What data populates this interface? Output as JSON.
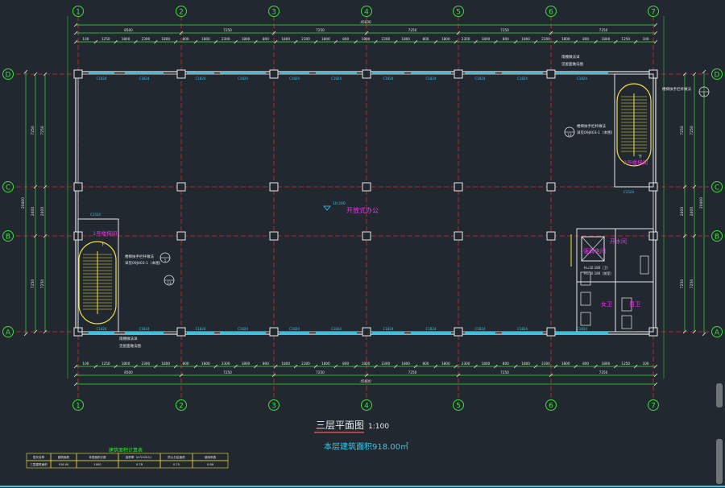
{
  "drawing": {
    "title": "三层平面图",
    "scale": "1:100",
    "area_note": "本层建筑面积918.00㎡"
  },
  "axes": {
    "columns": [
      "1",
      "2",
      "3",
      "4",
      "5",
      "6",
      "7"
    ],
    "rows": [
      "D",
      "C",
      "B",
      "A"
    ]
  },
  "dimensions": {
    "top_total": "45600",
    "bottom_total": "45600",
    "top_bays": [
      "8500",
      "7250",
      "7250",
      "7250",
      "7250",
      "7250",
      "8500"
    ],
    "bottom_bays": [
      "8500",
      "7250",
      "7250",
      "7250",
      "7250",
      "7250",
      "8500"
    ],
    "top_detail": [
      "100",
      "1250",
      "1800",
      "2300",
      "1800",
      "800",
      "1800",
      "2300",
      "1800",
      "800",
      "1800",
      "2300",
      "1800",
      "800",
      "1800",
      "2300",
      "1800",
      "800",
      "1800",
      "2300",
      "1800",
      "800",
      "1800",
      "2300",
      "1800",
      "800",
      "1800",
      "1250",
      "100"
    ],
    "bottom_detail": [
      "100",
      "1250",
      "1800",
      "2300",
      "1800",
      "800",
      "1800",
      "2300",
      "1800",
      "800",
      "1800",
      "2300",
      "1800",
      "800",
      "1800",
      "2300",
      "1800",
      "800",
      "1800",
      "2300",
      "1800",
      "800",
      "1800",
      "2300",
      "1800",
      "800",
      "1800",
      "1250",
      "100"
    ],
    "left_outer": "20400",
    "right_outer": "20400",
    "left_segments": [
      "7250",
      "2400",
      "7250"
    ],
    "right_segments": [
      "7250",
      "2400",
      "7250"
    ]
  },
  "windows": {
    "top": [
      "C1824",
      "C1824",
      "C1824",
      "C1824",
      "C1824",
      "C1824",
      "C1824",
      "C1824",
      "C1824",
      "C1824",
      "C1824"
    ],
    "bottom": [
      "C1824",
      "C1824",
      "C1824",
      "C1824",
      "C1824",
      "C1824",
      "C1824",
      "C1824",
      "C1824",
      "C1824",
      "C1824"
    ]
  },
  "rooms": {
    "main": "开放式办公",
    "stair_left": "1号楼梯间",
    "stair_right": "2号楼梯间",
    "open_area": "开水间",
    "equip_room": "强弱电间",
    "female_wc": "女卫",
    "male_wc": "男卫"
  },
  "annotations": {
    "elev_main": "10.200",
    "top_note": [
      "雨棚做法详",
      "见屋面做法图"
    ],
    "bottom_note": [
      "雨棚做法详",
      "见屋面做法图"
    ],
    "stair_note_left": [
      "楼梯扶手栏杆做法",
      "详见09J403-1（本图）"
    ],
    "stair_note_right": [
      "楼梯扶手栏杆做法",
      "详见09J403-1（本图）"
    ],
    "detail_ref_left": "13",
    "detail_ref_right": "13",
    "detail_ref_mark": "1",
    "wc_elev": [
      "H=10.180（卫）",
      "H=10.180（前室）"
    ],
    "upstairs": "下",
    "window_tag_stair": "C1524"
  },
  "schedule": {
    "title": "建筑面积计算表",
    "headers": [
      "层次名称",
      "建筑面积",
      "本层面积计数",
      "容积率（m²/100人）",
      "防火分区面积",
      "使用系数"
    ],
    "row": [
      "三层建筑面积",
      "918.00",
      "1000",
      "0.78",
      "0.75",
      "0.88"
    ]
  }
}
